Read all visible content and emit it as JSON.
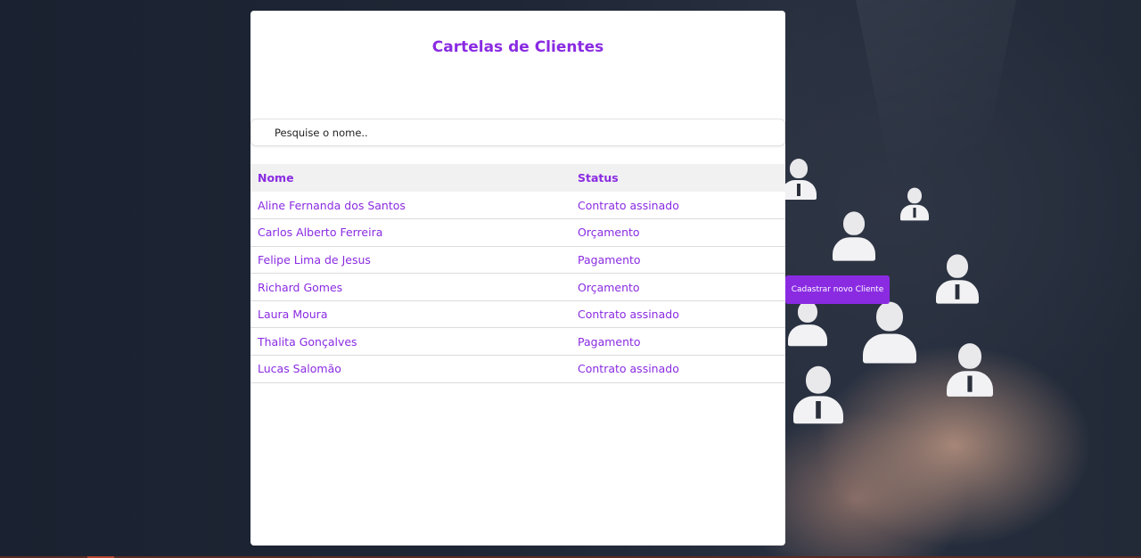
{
  "page": {
    "title": "Cartelas de Clientes"
  },
  "search": {
    "placeholder": "Pesquise o nome.."
  },
  "table": {
    "headers": {
      "name": "Nome",
      "status": "Status"
    },
    "rows": [
      {
        "name": "Aline Fernanda dos Santos",
        "status": "Contrato assinado"
      },
      {
        "name": "Carlos Alberto Ferreira",
        "status": "Orçamento"
      },
      {
        "name": "Felipe Lima de Jesus",
        "status": "Pagamento"
      },
      {
        "name": "Richard Gomes",
        "status": "Orçamento"
      },
      {
        "name": "Laura Moura",
        "status": "Contrato assinado"
      },
      {
        "name": "Thalita Gonçalves",
        "status": "Pagamento"
      },
      {
        "name": "Lucas Salomão",
        "status": "Contrato assinado"
      }
    ]
  },
  "actions": {
    "new_client_label": "Cadastrar novo Cliente"
  },
  "colors": {
    "accent": "#8a2be2",
    "card_background": "#ffffff",
    "header_row_background": "#f1f1f1"
  }
}
